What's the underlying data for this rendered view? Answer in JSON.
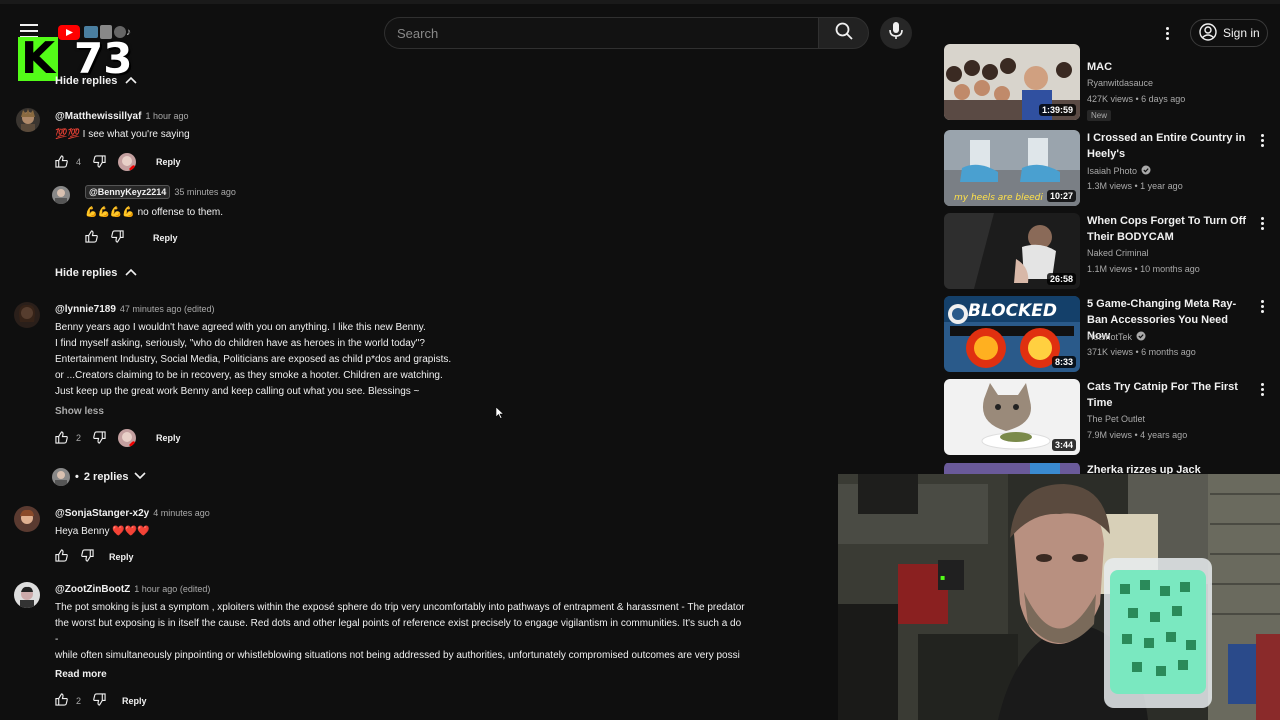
{
  "overlay": {
    "logo_letter": "K",
    "counter": "73"
  },
  "header": {
    "search_placeholder": "Search",
    "sign_in": "Sign in"
  },
  "comments": {
    "top_toggle": "Hide replies",
    "mid_toggle": "Hide replies",
    "c1": {
      "handle": "@Matthewissillyaf",
      "time": "1 hour ago",
      "text": "💯💯 I see what you're saying",
      "likes": "4",
      "reply": "Reply"
    },
    "c2": {
      "mention": "@BennyKeyz2214",
      "time": "35 minutes ago",
      "text": "💪💪💪💪 no offense to them.",
      "reply": "Reply"
    },
    "c3": {
      "handle": "@lynnie7189",
      "time": "47 minutes ago (edited)",
      "lines": [
        "Benny years ago I wouldn't have agreed with you on anything. I like this new Benny.",
        "I find myself asking, seriously, \"who do children have as heroes in the world today\"?",
        "Entertainment Industry, Social Media, Politicians are exposed as child p*dos and grapists.",
        "or ...Creators claiming to be in recovery, as they smoke a hooter.  Children are watching.",
        "Just keep up the great work Benny and keep calling out what you see. Blessings ~"
      ],
      "show_less": "Show less",
      "likes": "2",
      "reply": "Reply",
      "replies_toggle": "2 replies",
      "dot": "•"
    },
    "c4": {
      "handle": "@SonjaStanger-x2y",
      "time": "4 minutes ago",
      "text": "Heya Benny ❤️❤️❤️",
      "reply": "Reply"
    },
    "c5": {
      "handle": "@ZootZinBootZ",
      "time": "1 hour ago (edited)",
      "lines": [
        "The pot smoking is just a symptom , xploiters within the exposé sphere do trip very uncomfortably into pathways of entrapment & harassment - The predator",
        "the worst but exposing is in itself the cause. Red dots and other legal points of reference exist precisely to engage vigilantism in communities.  It's such a do",
        "-",
        "while often simultaneously pinpointing or whistleblowing situations not being addressed by authorities, unfortunately compromised outcomes are very possi"
      ],
      "read_more": "Read more",
      "likes": "2",
      "reply": "Reply"
    }
  },
  "sidebar": {
    "videos": [
      {
        "title": "MAC",
        "channel": "Ryanwitdasauce",
        "meta": "427K views • 6 days ago",
        "badge": "New",
        "duration": "1:39:59",
        "verified": false
      },
      {
        "title": "I Crossed an Entire Country in Heely's",
        "channel": "Isaiah Photo",
        "meta": "1.3M views • 1 year ago",
        "duration": "10:27",
        "thumb_caption": "my heels are bleedi",
        "verified": true
      },
      {
        "title": "When Cops Forget To Turn Off Their BODYCAM",
        "channel": "Naked Criminal",
        "meta": "1.1M views • 10 months ago",
        "duration": "26:58",
        "verified": false
      },
      {
        "title": "5 Game-Changing Meta Ray-Ban Accessories You Need Now",
        "channel": "HotshotTek",
        "meta": "371K views • 6 months ago",
        "duration": "8:33",
        "thumb_caption": "BLOCKED",
        "verified": true
      },
      {
        "title": "Cats Try Catnip For The First Time",
        "channel": "The Pet Outlet",
        "meta": "7.9M views • 4 years ago",
        "duration": "3:44",
        "verified": false
      },
      {
        "title": "Zherka rizzes up Jack Doherty's"
      }
    ]
  },
  "colors": {
    "background": "#0f0f0f",
    "kick_green": "#53fc18",
    "youtube_red": "#ff0000"
  }
}
